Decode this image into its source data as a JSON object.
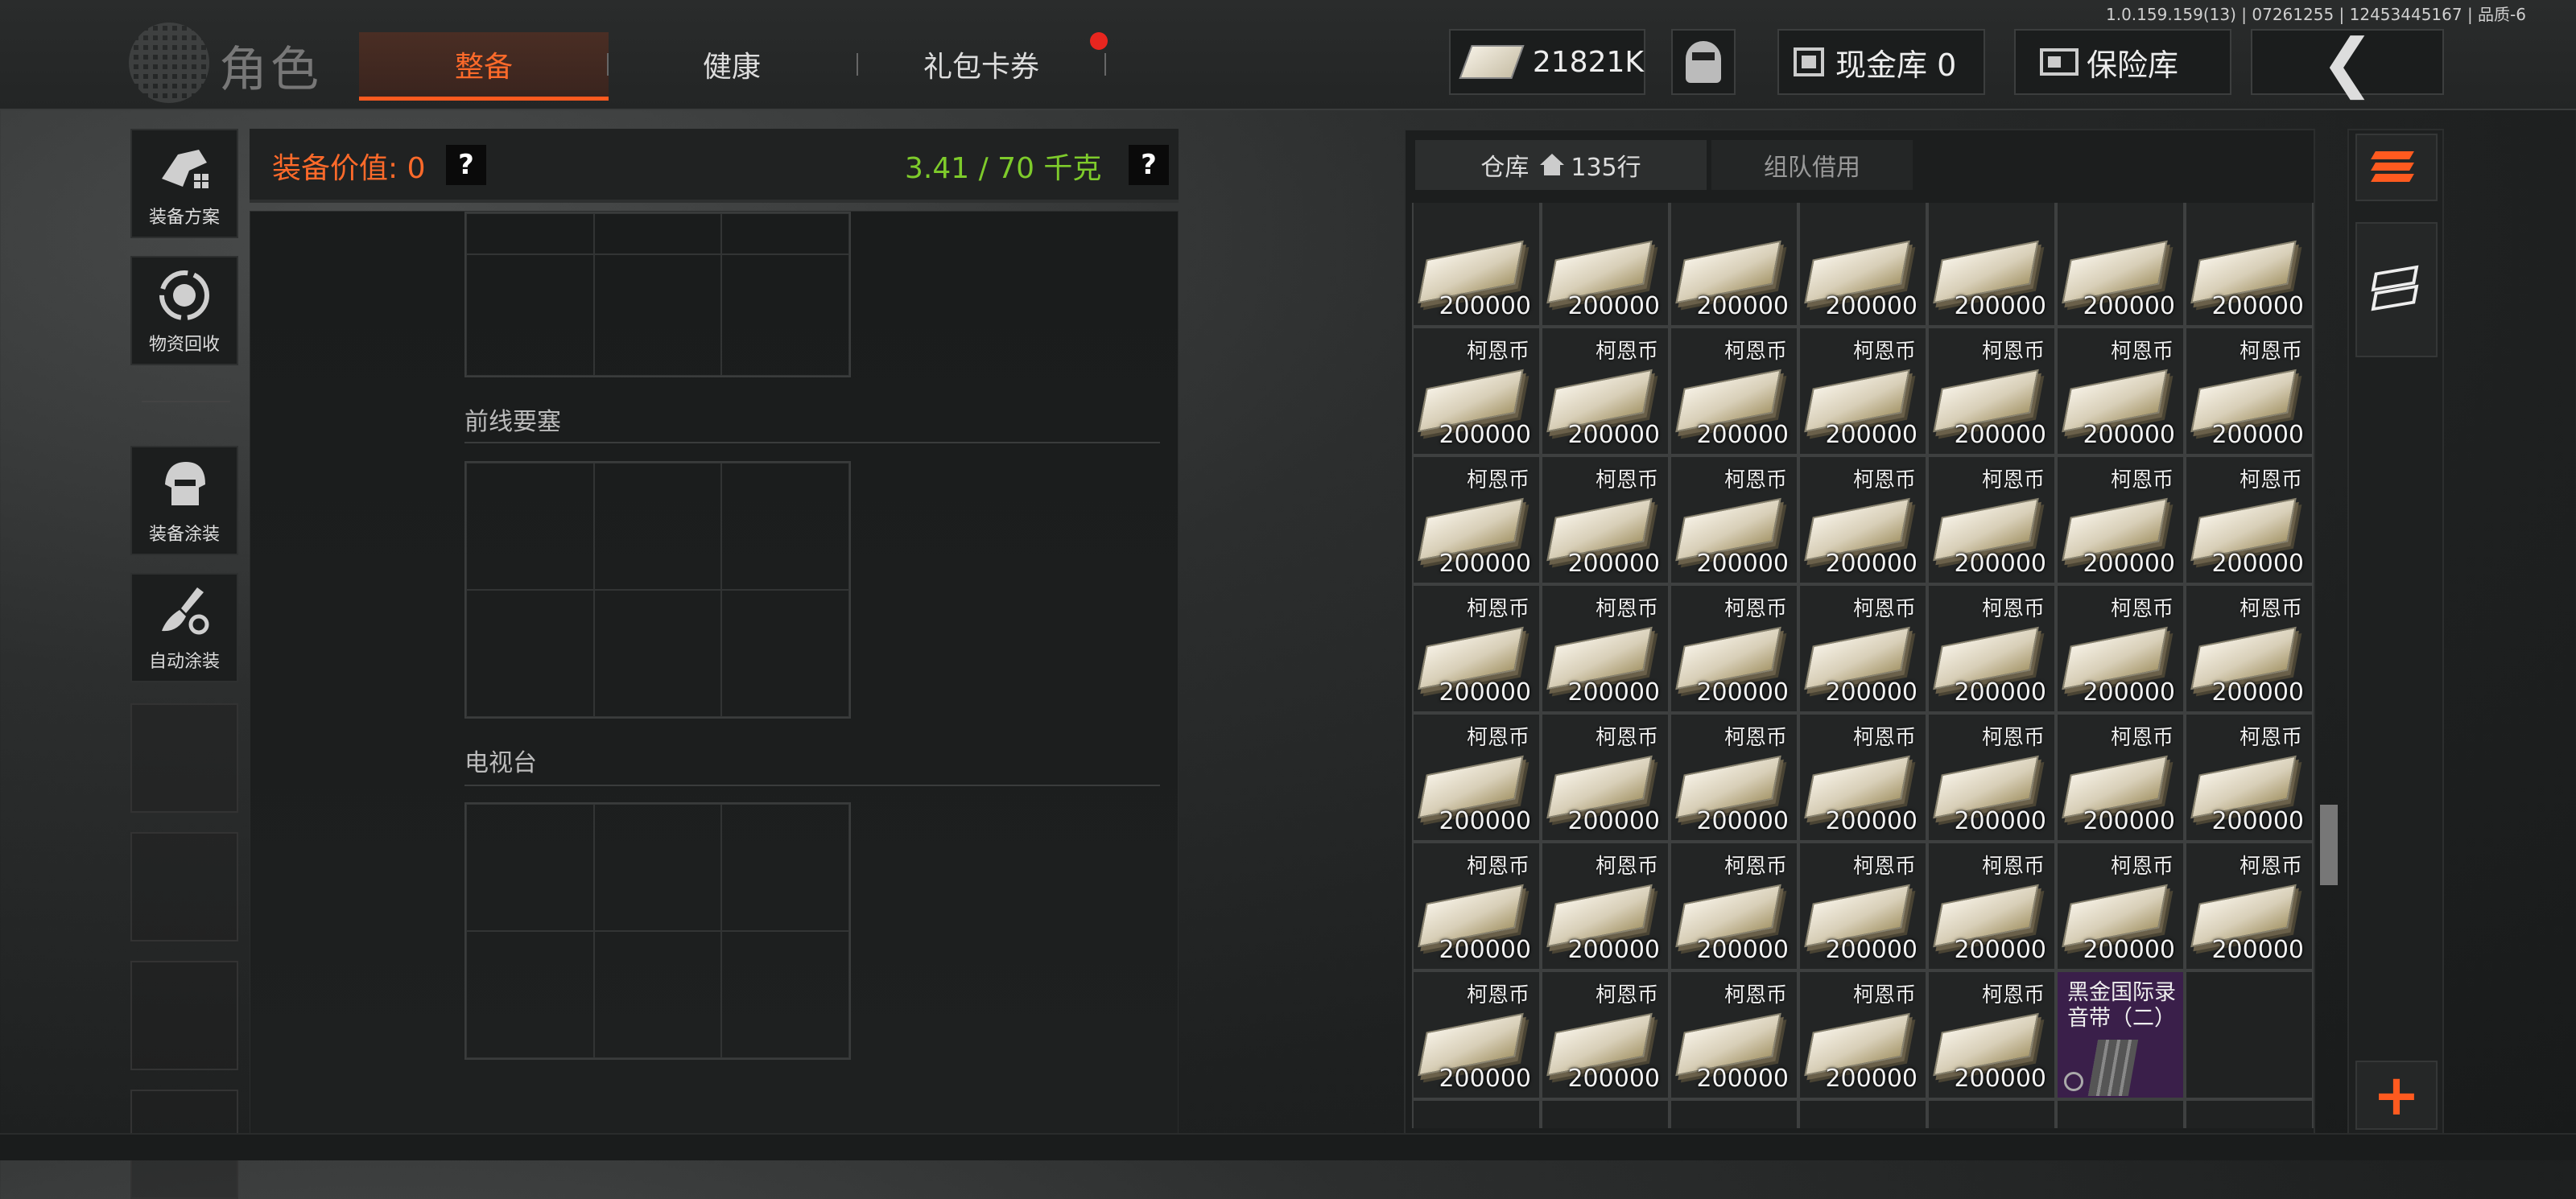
{
  "top": {
    "brand_title": "角色",
    "tabs": [
      {
        "label": "整备",
        "active": true
      },
      {
        "label": "健康",
        "active": false
      },
      {
        "label": "礼包卡券",
        "active": false
      }
    ],
    "version_text": "1.0.159.159(13) | 07261255 | 12453445167 | 品质-6",
    "money": "21821K",
    "cash_vault": "现金库 0",
    "safe": "保险库",
    "back_icon": "chevron-left-icon"
  },
  "sidebar": {
    "items": [
      {
        "label": "装备方案",
        "icon": "gear-plan-icon"
      },
      {
        "label": "物资回收",
        "icon": "recycle-icon"
      },
      {
        "label": "装备涂装",
        "icon": "helmet-icon"
      },
      {
        "label": "自动涂装",
        "icon": "paint-brush-icon"
      }
    ]
  },
  "loadout": {
    "value_label": "装备价值: 0",
    "weight_label": "3.41 / 70 千克",
    "help": "?",
    "sections": [
      {
        "title": "前线要塞"
      },
      {
        "title": "电视台"
      }
    ]
  },
  "inventory": {
    "tab_storage": "仓库",
    "tab_storage_rows": "135行",
    "tab_team": "组队借用",
    "item_name": "柯恩币",
    "item_qty": "200000",
    "special_item_name": "黑金国际录音带（二）",
    "colors": {
      "accent": "#ff5a1f",
      "weight": "#7ecb2b",
      "tape_bg": "#3a1f4a"
    }
  }
}
